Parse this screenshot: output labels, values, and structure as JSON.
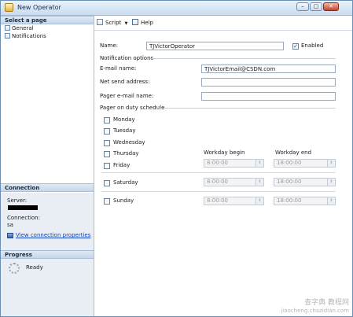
{
  "window": {
    "title": "New Operator",
    "buttons": {
      "minimize": "–",
      "maximize": "▢",
      "close": "✕"
    }
  },
  "left_pane": {
    "select_page_header": "Select a page",
    "pages": [
      {
        "label": "General"
      },
      {
        "label": "Notifications"
      }
    ],
    "connection_header": "Connection",
    "server_label": "Server:",
    "connection_label": "Connection:",
    "connection_value": "sa",
    "view_connection_link": "View connection properties",
    "progress_header": "Progress",
    "progress_status": "Ready"
  },
  "toolbar": {
    "script_label": "Script",
    "help_label": "Help"
  },
  "form": {
    "name_label": "Name:",
    "name_value": "TJVictorOperator",
    "enabled_label": "Enabled",
    "enabled_checked": true,
    "notification_options_label": "Notification options",
    "email_label": "E-mail name:",
    "email_value": "TJVictorEmail@CSDN.com",
    "net_send_label": "Net send address:",
    "net_send_value": "",
    "pager_email_label": "Pager e-mail name:",
    "pager_email_value": "",
    "pager_schedule_label": "Pager on duty schedule",
    "days": [
      "Monday",
      "Tuesday",
      "Wednesday",
      "Thursday",
      "Friday",
      "Saturday",
      "Sunday"
    ],
    "workday_begin_label": "Workday begin",
    "workday_end_label": "Workday end",
    "weekday_begin": "8:00:00",
    "weekday_end": "18:00:00",
    "saturday_begin": "8:00:00",
    "saturday_end": "18:00:00",
    "sunday_begin": "8:00:00",
    "sunday_end": "18:00:00"
  },
  "watermark": {
    "line1": "查字典 教程网",
    "line2": "jiaocheng.chazidian.com"
  },
  "colors": {
    "title_bg": "#c9dcf0",
    "section_bg": "#c6d7ea",
    "link": "#1240b8",
    "close_button": "#c8432a"
  }
}
